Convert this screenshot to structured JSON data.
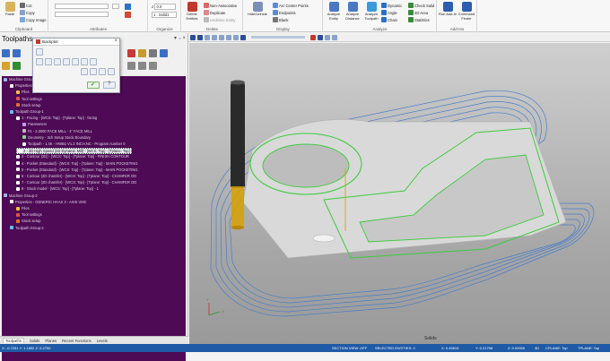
{
  "ribbon": {
    "clipboard": {
      "paste": "Paste",
      "cut": "Cut",
      "copy": "Copy",
      "copy_image": "Copy Image",
      "label": "Clipboard"
    },
    "attributes": {
      "label": "Attributes"
    },
    "organize": {
      "level_value": "0.0",
      "level_name": "1 : Solid1",
      "label": "Organize"
    },
    "delete": {
      "delete_entities": "Delete Entities",
      "non_associative": "Non-Associative",
      "duplicate": "Duplicate",
      "undelete": "Undelete Entity",
      "label": "Delete"
    },
    "display": {
      "hide_unhide": "Hide/Unhide",
      "arc_center_points": "Arc Center Points",
      "endpoints": "Endpoints",
      "blank": "Blank",
      "label": "Display"
    },
    "analyze": {
      "analyze_entity": "Analyze Entity",
      "analyze_distance": "Analyze Distance",
      "analyze_toolpath": "Analyze Toolpath",
      "dynamic": "Dynamic",
      "angle": "Angle",
      "chain": "Chain",
      "check_solid": "Check Solid",
      "area_2d": "2D Area",
      "statistics": "Statistics",
      "label": "Analyze"
    },
    "addins": {
      "run_addin": "Run Add-In",
      "command_finder": "Command Finder",
      "label": "Add-Ins"
    }
  },
  "panel": {
    "title": "Toolpaths",
    "pin": "▾ ₊ ×"
  },
  "dialog": {
    "title": "Backplot"
  },
  "tree": [
    {
      "label": "Machine Group-1",
      "indent": 0,
      "icon": "#9fb7e8"
    },
    {
      "label": "Properties - Mill Default MM",
      "indent": 1,
      "icon": "#ffffff"
    },
    {
      "label": "Files",
      "indent": 2,
      "icon": "#f0c040"
    },
    {
      "label": "Tool settings",
      "indent": 2,
      "icon": "#e05050"
    },
    {
      "label": "Stock setup",
      "indent": 2,
      "icon": "#e07030"
    },
    {
      "label": "Toolpath Group-1",
      "indent": 1,
      "icon": "#60c0ff"
    },
    {
      "label": "1 - Facing - [WCS: Top] - [Tplane: Top] - facing",
      "indent": 2,
      "icon": "#ffffff"
    },
    {
      "label": "Parameters",
      "indent": 3,
      "icon": "#c0a0ff"
    },
    {
      "label": "#1 - 2.0000 FACE MILL - 1\" FACE MILL",
      "indent": 3,
      "icon": "#c0c0c0"
    },
    {
      "label": "Geometry - 3ch Setup Stock Boundary",
      "indent": 3,
      "icon": "#80e080"
    },
    {
      "label": "Toolpath - 1.4K - HWB1 V1.2 INCH.NC - Program number 0",
      "indent": 3,
      "icon": "#f0f0f0"
    },
    {
      "label": "2 - 2D High Speed (2D Dynamic Mill) - [WCS: Top] - [Tplane: Top]",
      "indent": 2,
      "icon": "#ffffff",
      "selected": true
    },
    {
      "label": "3 - Contour (2D) - [WCS: Top] - [Tplane: Top] - FINISH CONTOUR",
      "indent": 2,
      "icon": "#ffffff"
    },
    {
      "label": "4 - Pocket (Standard) - [WCS: Top] - [Tplane: Top] - MAIN POCKETING",
      "indent": 2,
      "icon": "#ffffff"
    },
    {
      "label": "5 - Pocket (Standard) - [WCS: Top] - [Tplane: Top] - MAIN POCKETING",
      "indent": 2,
      "icon": "#ffffff"
    },
    {
      "label": "6 - Contour (2D chamfer) - [WCS: Top] - [Tplane: Top] - CHAMFER OD",
      "indent": 2,
      "icon": "#ffffff"
    },
    {
      "label": "7 - Contour (2D chamfer) - [WCS: Top] - [Tplane: Top] - CHAMFER OD",
      "indent": 2,
      "icon": "#ffffff"
    },
    {
      "label": "8 - Stock model - [WCS: Top] - [Tplane: Top] - 1",
      "indent": 2,
      "icon": "#ffffff"
    },
    {
      "label": "Machine Group-2",
      "indent": 0,
      "icon": "#9fb7e8"
    },
    {
      "label": "Properties - GENERIC HAAS 3 - AXIS VMC",
      "indent": 1,
      "icon": "#ffffff"
    },
    {
      "label": "Files",
      "indent": 2,
      "icon": "#f0c040"
    },
    {
      "label": "Tool settings",
      "indent": 2,
      "icon": "#e05050"
    },
    {
      "label": "Stock setup",
      "indent": 2,
      "icon": "#e07030"
    },
    {
      "label": "Toolpath Group-2",
      "indent": 1,
      "icon": "#60c0ff"
    }
  ],
  "bottom_tabs": [
    "Toolpaths",
    "Solids",
    "Planes",
    "Recent Functions",
    "Levels"
  ],
  "viewport": {
    "view_label": "Solids",
    "axis_x": "X",
    "axis_y": "Y"
  },
  "status": {
    "coords_left": "X: -0.7291  Y: 1.1852  Z: 0.2750",
    "section_view": "SECTION VIEW: OFF",
    "selected": "SELECTED ENTITIES: 0",
    "x": "X: 0.45619",
    "y": "Y: 0.21798",
    "z": "Z: 0.00000",
    "mode": "3D",
    "cplane": "CPLANE: Top",
    "tplane": "TPLANE: Top"
  },
  "colors": {
    "tree_bg": "#4e0a55",
    "status_bg": "#1f5aa6",
    "toolpath": "#4a7ec8",
    "contour": "#3ccc3c",
    "tool": "#d8a000"
  }
}
